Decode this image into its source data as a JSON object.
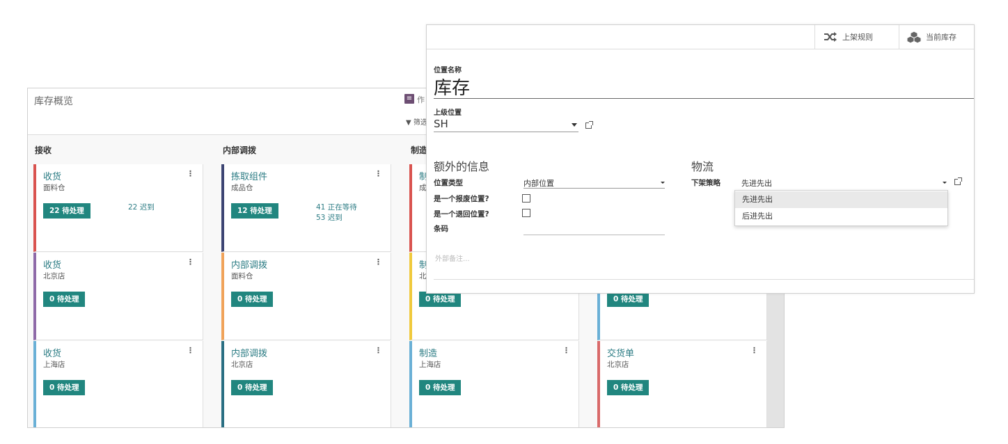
{
  "overview": {
    "title": "库存概览",
    "view_label": "作",
    "filter_label": "▼ 筛选",
    "columns": [
      {
        "title": "接收"
      },
      {
        "title": "内部调拨"
      },
      {
        "title": "制造"
      }
    ],
    "cards": [
      {
        "title": "收货",
        "subtitle": "面料仓",
        "button": "22 待处理",
        "stat1": "22 迟到",
        "stat2": "",
        "color": "#d9534f"
      },
      {
        "title": "收货",
        "subtitle": "北京店",
        "button": "0 待处理",
        "stat1": "",
        "stat2": "",
        "color": "#8e6aa8"
      },
      {
        "title": "收货",
        "subtitle": "上海店",
        "button": "0 待处理",
        "stat1": "",
        "stat2": "",
        "color": "#6ab0d6"
      },
      {
        "title": "拣取组件",
        "subtitle": "成品仓",
        "button": "12 待处理",
        "stat1": "41 正在等待",
        "stat2": "53 迟到",
        "color": "#3d4573"
      },
      {
        "title": "内部调拨",
        "subtitle": "面料仓",
        "button": "0 待处理",
        "stat1": "",
        "stat2": "",
        "color": "#f0a35a"
      },
      {
        "title": "内部调拨",
        "subtitle": "北京店",
        "button": "0 待处理",
        "stat1": "",
        "stat2": "",
        "color": "#2a6f83"
      },
      {
        "title": "制",
        "subtitle": "成",
        "button": "",
        "stat1": "",
        "stat2": "",
        "color": "#d9534f"
      },
      {
        "title": "制",
        "subtitle": "北",
        "button": "0 待处理",
        "stat1": "",
        "stat2": "",
        "color": "#f0c93c"
      },
      {
        "title": "制造",
        "subtitle": "上海店",
        "button": "0 待处理",
        "stat1": "",
        "stat2": "",
        "color": "#6ab0d6"
      },
      {
        "title": "",
        "subtitle": "",
        "button": "0 待处理",
        "stat1": "",
        "stat2": "",
        "color": "#6ab0d6"
      },
      {
        "title": "交货单",
        "subtitle": "北京店",
        "button": "0 待处理",
        "stat1": "",
        "stat2": "",
        "color": "#d96a6a"
      }
    ]
  },
  "form": {
    "smart_buttons": {
      "putaway": "上架规则",
      "stock": "当前库存"
    },
    "name_label": "位置名称",
    "name_value": "库存",
    "parent_label": "上级位置",
    "parent_value": "SH",
    "section_extra": "额外的信息",
    "section_logistics": "物流",
    "location_type_label": "位置类型",
    "location_type_value": "内部位置",
    "scrap_label": "是一个报废位置?",
    "return_label": "是一个退回位置?",
    "barcode_label": "条码",
    "removal_label": "下架策略",
    "removal_value": "先进先出",
    "note_placeholder": "外部备注...",
    "dropdown_options": [
      "先进先出",
      "后进先出"
    ]
  }
}
